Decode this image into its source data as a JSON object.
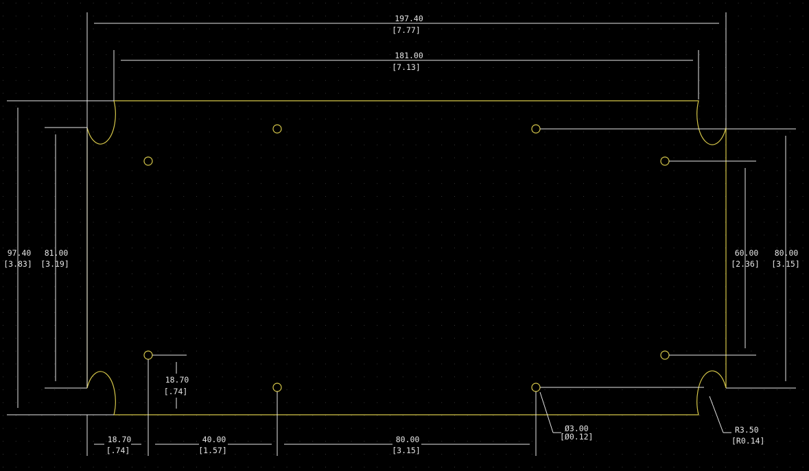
{
  "theme": {
    "background": "#000000",
    "grid_dot_color": "#3a3a3a",
    "board_outline_color": "#d7c84a",
    "dimension_color": "#e8e8e8"
  },
  "dimensions": {
    "overall_width": {
      "mm": "197.40",
      "in": "[7.77]"
    },
    "inner_width": {
      "mm": "181.00",
      "in": "[7.13]"
    },
    "overall_height": {
      "mm": "97.40",
      "in": "[3.83]"
    },
    "inner_height": {
      "mm": "81.00",
      "in": "[3.19]"
    },
    "right_hole_spacing": {
      "mm": "60.00",
      "in": "[2.36]"
    },
    "right_height": {
      "mm": "80.00",
      "in": "[3.15]"
    },
    "hole_to_edge_v": {
      "mm": "18.70",
      "in": "[.74]"
    },
    "hole_to_edge_h": {
      "mm": "18.70",
      "in": "[.74]"
    },
    "hole_spacing_40": {
      "mm": "40.00",
      "in": "[1.57]"
    },
    "hole_spacing_80": {
      "mm": "80.00",
      "in": "[3.15]"
    },
    "hole_diameter": {
      "mm": "Ø3.00",
      "in": "[Ø0.12]"
    },
    "corner_radius": {
      "mm": "R3.50",
      "in": "[R0.14]"
    }
  }
}
